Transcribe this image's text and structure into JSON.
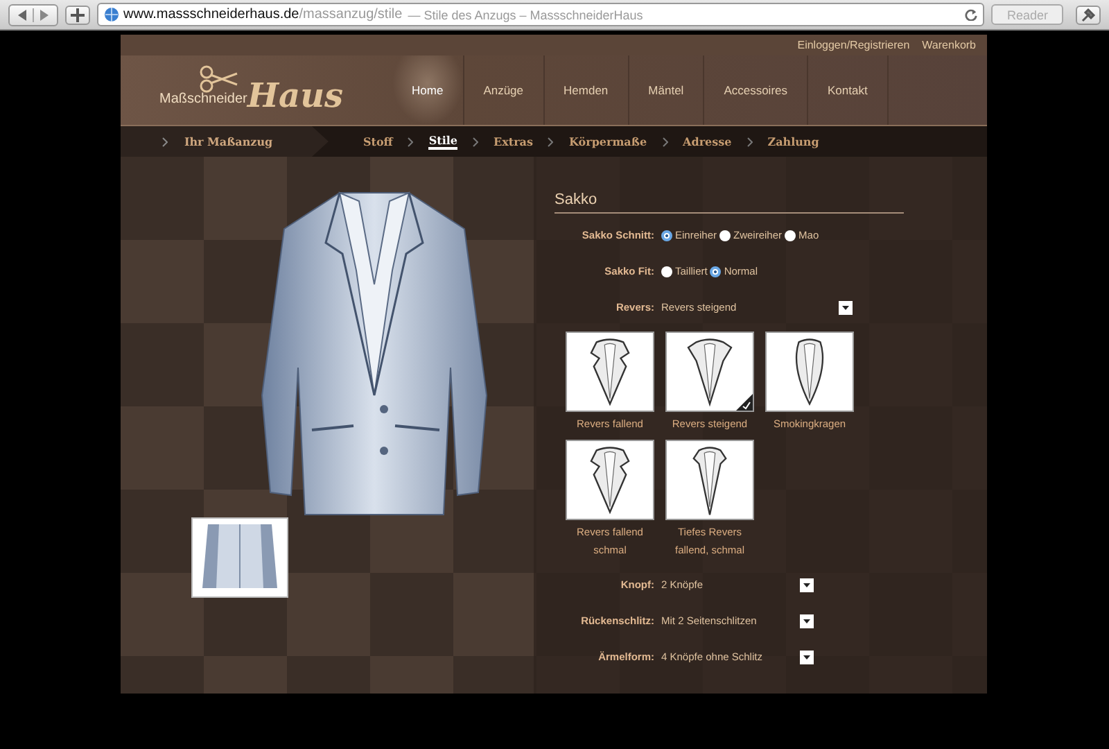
{
  "browser": {
    "url_host": "www.massschneiderhaus.de",
    "url_path": "/massanzug/stile",
    "page_title": "— Stile des Anzugs – MassschneiderHaus",
    "reader": "Reader"
  },
  "top_links": [
    "Einloggen/Registrieren",
    "Warenkorb"
  ],
  "logo": {
    "small": "Maßschneider",
    "large": "Haus"
  },
  "nav": [
    {
      "label": "Home",
      "selected": true
    },
    {
      "label": "Anzüge",
      "selected": false
    },
    {
      "label": "Hemden",
      "selected": false
    },
    {
      "label": "Mäntel",
      "selected": false
    },
    {
      "label": "Accessoires",
      "selected": false
    },
    {
      "label": "Kontakt",
      "selected": false
    }
  ],
  "steps": {
    "start": "Ihr Maßanzug",
    "items": [
      {
        "label": "Stoff",
        "selected": false
      },
      {
        "label": "Stile",
        "selected": true
      },
      {
        "label": "Extras",
        "selected": false
      },
      {
        "label": "Körpermaße",
        "selected": false
      },
      {
        "label": "Adresse",
        "selected": false
      },
      {
        "label": "Zahlung",
        "selected": false
      }
    ]
  },
  "form": {
    "title": "Sakko",
    "radio_groups": [
      {
        "label": "Sakko Schnitt:",
        "options": [
          {
            "label": "Einreiher",
            "selected": true
          },
          {
            "label": "Zweireiher",
            "selected": false
          },
          {
            "label": "Mao",
            "selected": false
          }
        ]
      },
      {
        "label": "Sakko Fit:",
        "options": [
          {
            "label": "Tailliert",
            "selected": false
          },
          {
            "label": "Normal",
            "selected": true
          }
        ]
      }
    ],
    "revers": {
      "label": "Revers:",
      "value": "Revers steigend"
    },
    "lapels": [
      {
        "label": "Revers fallend",
        "kind": "notch",
        "selected": false
      },
      {
        "label": "Revers steigend",
        "kind": "peak",
        "selected": true
      },
      {
        "label": "Smokingkragen",
        "kind": "shawl",
        "selected": false
      },
      {
        "label": "Revers fallend schmal",
        "kind": "notch",
        "selected": false
      },
      {
        "label": "Tiefes Revers fallend, schmal",
        "kind": "deep",
        "selected": false
      }
    ],
    "dropdowns": [
      {
        "label": "Knopf:",
        "value": "2 Knöpfe"
      },
      {
        "label": "Rückenschlitz:",
        "value": "Mit 2 Seitenschlitzen"
      },
      {
        "label": "Ärmelform:",
        "value": "4 Knöpfe ohne Schlitz"
      }
    ]
  }
}
